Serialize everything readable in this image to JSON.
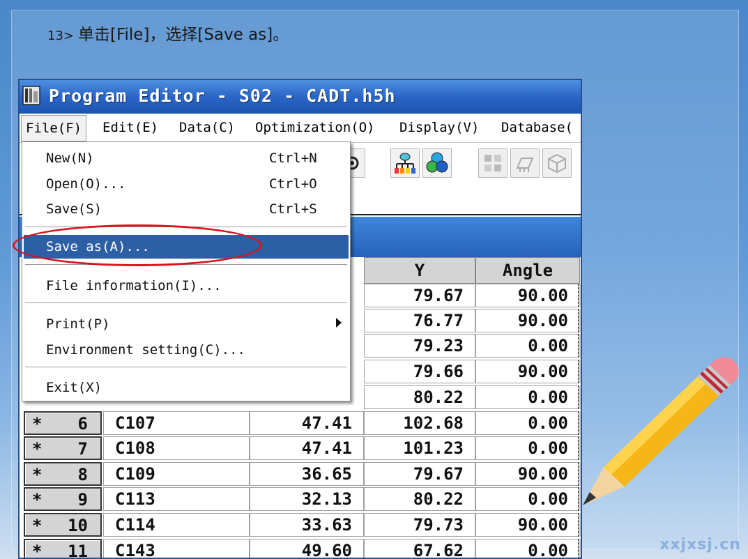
{
  "caption": {
    "step": "13>",
    "text": "单击[File]，选择[Save as]。"
  },
  "window": {
    "title": "Program Editor - S02 - CADT.h5h"
  },
  "menubar": {
    "file": "File(F)",
    "edit": "Edit(E)",
    "data": "Data(C)",
    "optimization": "Optimization(O)",
    "display": "Display(V)",
    "database": "Database("
  },
  "file_menu": {
    "new": {
      "label": "New(N)",
      "shortcut": "Ctrl+N"
    },
    "open": {
      "label": "Open(O)...",
      "shortcut": "Ctrl+O"
    },
    "save": {
      "label": "Save(S)",
      "shortcut": "Ctrl+S"
    },
    "save_as": {
      "label": "Save as(A)..."
    },
    "file_information": {
      "label": "File information(I)..."
    },
    "print": {
      "label": "Print(P)"
    },
    "environment_setting": {
      "label": "Environment setting(C)..."
    },
    "exit": {
      "label": "Exit(X)"
    }
  },
  "grid": {
    "headers": {
      "y": "Y",
      "angle": "Angle"
    },
    "visible_rows": [
      {
        "y": "79.67",
        "angle": "90.00"
      },
      {
        "y": "76.77",
        "angle": "90.00"
      },
      {
        "y": "79.23",
        "angle": "0.00"
      },
      {
        "y": "79.66",
        "angle": "90.00"
      },
      {
        "y": "80.22",
        "angle": "0.00"
      }
    ],
    "rows": [
      {
        "mark": "*",
        "no": "6",
        "ref": "C107",
        "x": "47.41",
        "y": "102.68",
        "angle": "0.00"
      },
      {
        "mark": "*",
        "no": "7",
        "ref": "C108",
        "x": "47.41",
        "y": "101.23",
        "angle": "0.00"
      },
      {
        "mark": "*",
        "no": "8",
        "ref": "C109",
        "x": "36.65",
        "y": "79.67",
        "angle": "90.00"
      },
      {
        "mark": "*",
        "no": "9",
        "ref": "C113",
        "x": "32.13",
        "y": "80.22",
        "angle": "0.00"
      },
      {
        "mark": "*",
        "no": "10",
        "ref": "C114",
        "x": "33.63",
        "y": "79.73",
        "angle": "90.00"
      },
      {
        "mark": "*",
        "no": "11",
        "ref": "C143",
        "x": "49.60",
        "y": "67.62",
        "angle": "0.00"
      }
    ]
  },
  "watermark": "xxjxsj.cn",
  "colors": {
    "highlight": "#d8141c",
    "selection": "#2d5fa5",
    "titlebar": "#2a66c8"
  },
  "icons": [
    "program-app-icon",
    "component-tree-icon",
    "color-circles-icon",
    "grid-icon",
    "feeder-icon",
    "box-icon",
    "pencil-illustration"
  ]
}
